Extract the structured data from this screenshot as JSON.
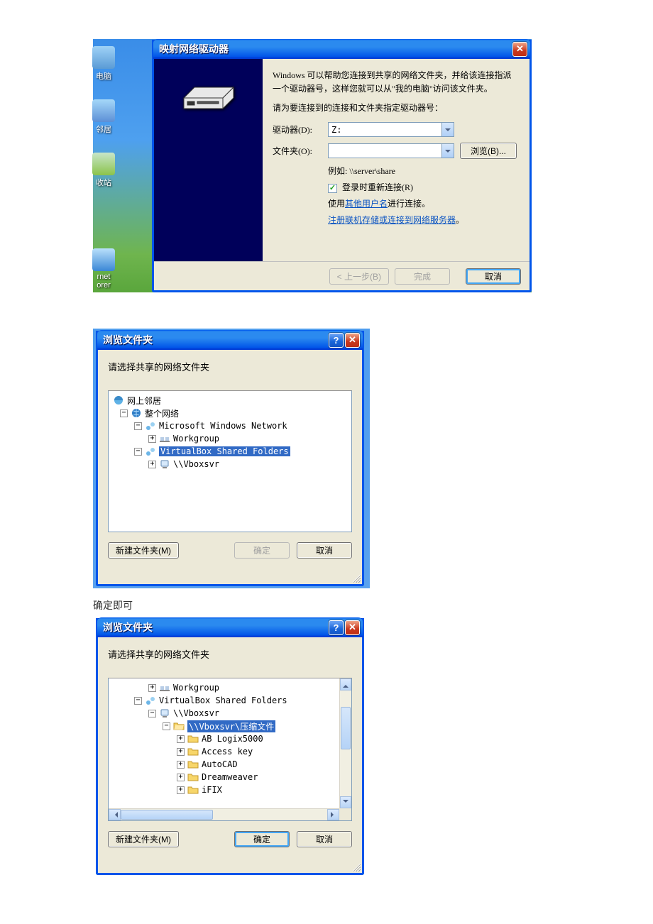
{
  "caption": "确定即可",
  "mapDrive": {
    "title": "映射网络驱动器",
    "description": "Windows 可以帮助您连接到共享的网络文件夹，并给该连接指派一个驱动器号，这样您就可以从\"我的电脑\"访问该文件夹。",
    "prompt": "请为要连接到的连接和文件夹指定驱动器号：",
    "driveLabel": "驱动器(D):",
    "driveValue": "Z:",
    "folderLabel": "文件夹(O):",
    "folderValue": "",
    "browseBtn": "浏览(B)...",
    "example": "例如: \\\\server\\share",
    "reconnect": "登录时重新连接(R)",
    "credsPrefix": "使用",
    "credsLink": "其他用户名",
    "credsSuffix": "进行连接。",
    "signupLink": "注册联机存储或连接到网络服务器",
    "signupSuffix": "。",
    "backBtn": "< 上一步(B)",
    "finishBtn": "完成",
    "cancelBtn": "取消"
  },
  "browse1": {
    "title": "浏览文件夹",
    "instruction": "请选择共享的网络文件夹",
    "newFolderBtn": "新建文件夹(M)",
    "okBtn": "确定",
    "cancelBtn": "取消",
    "tree": {
      "networkPlaces": "网上邻居",
      "entireNetwork": "整个网络",
      "msNetwork": "Microsoft Windows Network",
      "workgroup": "Workgroup",
      "vboxShared": "VirtualBox Shared Folders",
      "vboxsvr": "\\\\Vboxsvr"
    }
  },
  "browse2": {
    "title": "浏览文件夹",
    "instruction": "请选择共享的网络文件夹",
    "newFolderBtn": "新建文件夹(M)",
    "okBtn": "确定",
    "cancelBtn": "取消",
    "tree": {
      "workgroup": "Workgroup",
      "vboxShared": "VirtualBox Shared Folders",
      "vboxsvr": "\\\\Vboxsvr",
      "sharePath": "\\\\Vboxsvr\\压缩文件",
      "f1": "AB Logix5000",
      "f2": "Access key",
      "f3": "AutoCAD",
      "f4": "Dreamweaver",
      "f5": "iFIX"
    }
  },
  "desktop": {
    "ico1": "电脑",
    "ico2": "邻居",
    "ico3": "收站",
    "ico4": "rnet\norer"
  }
}
